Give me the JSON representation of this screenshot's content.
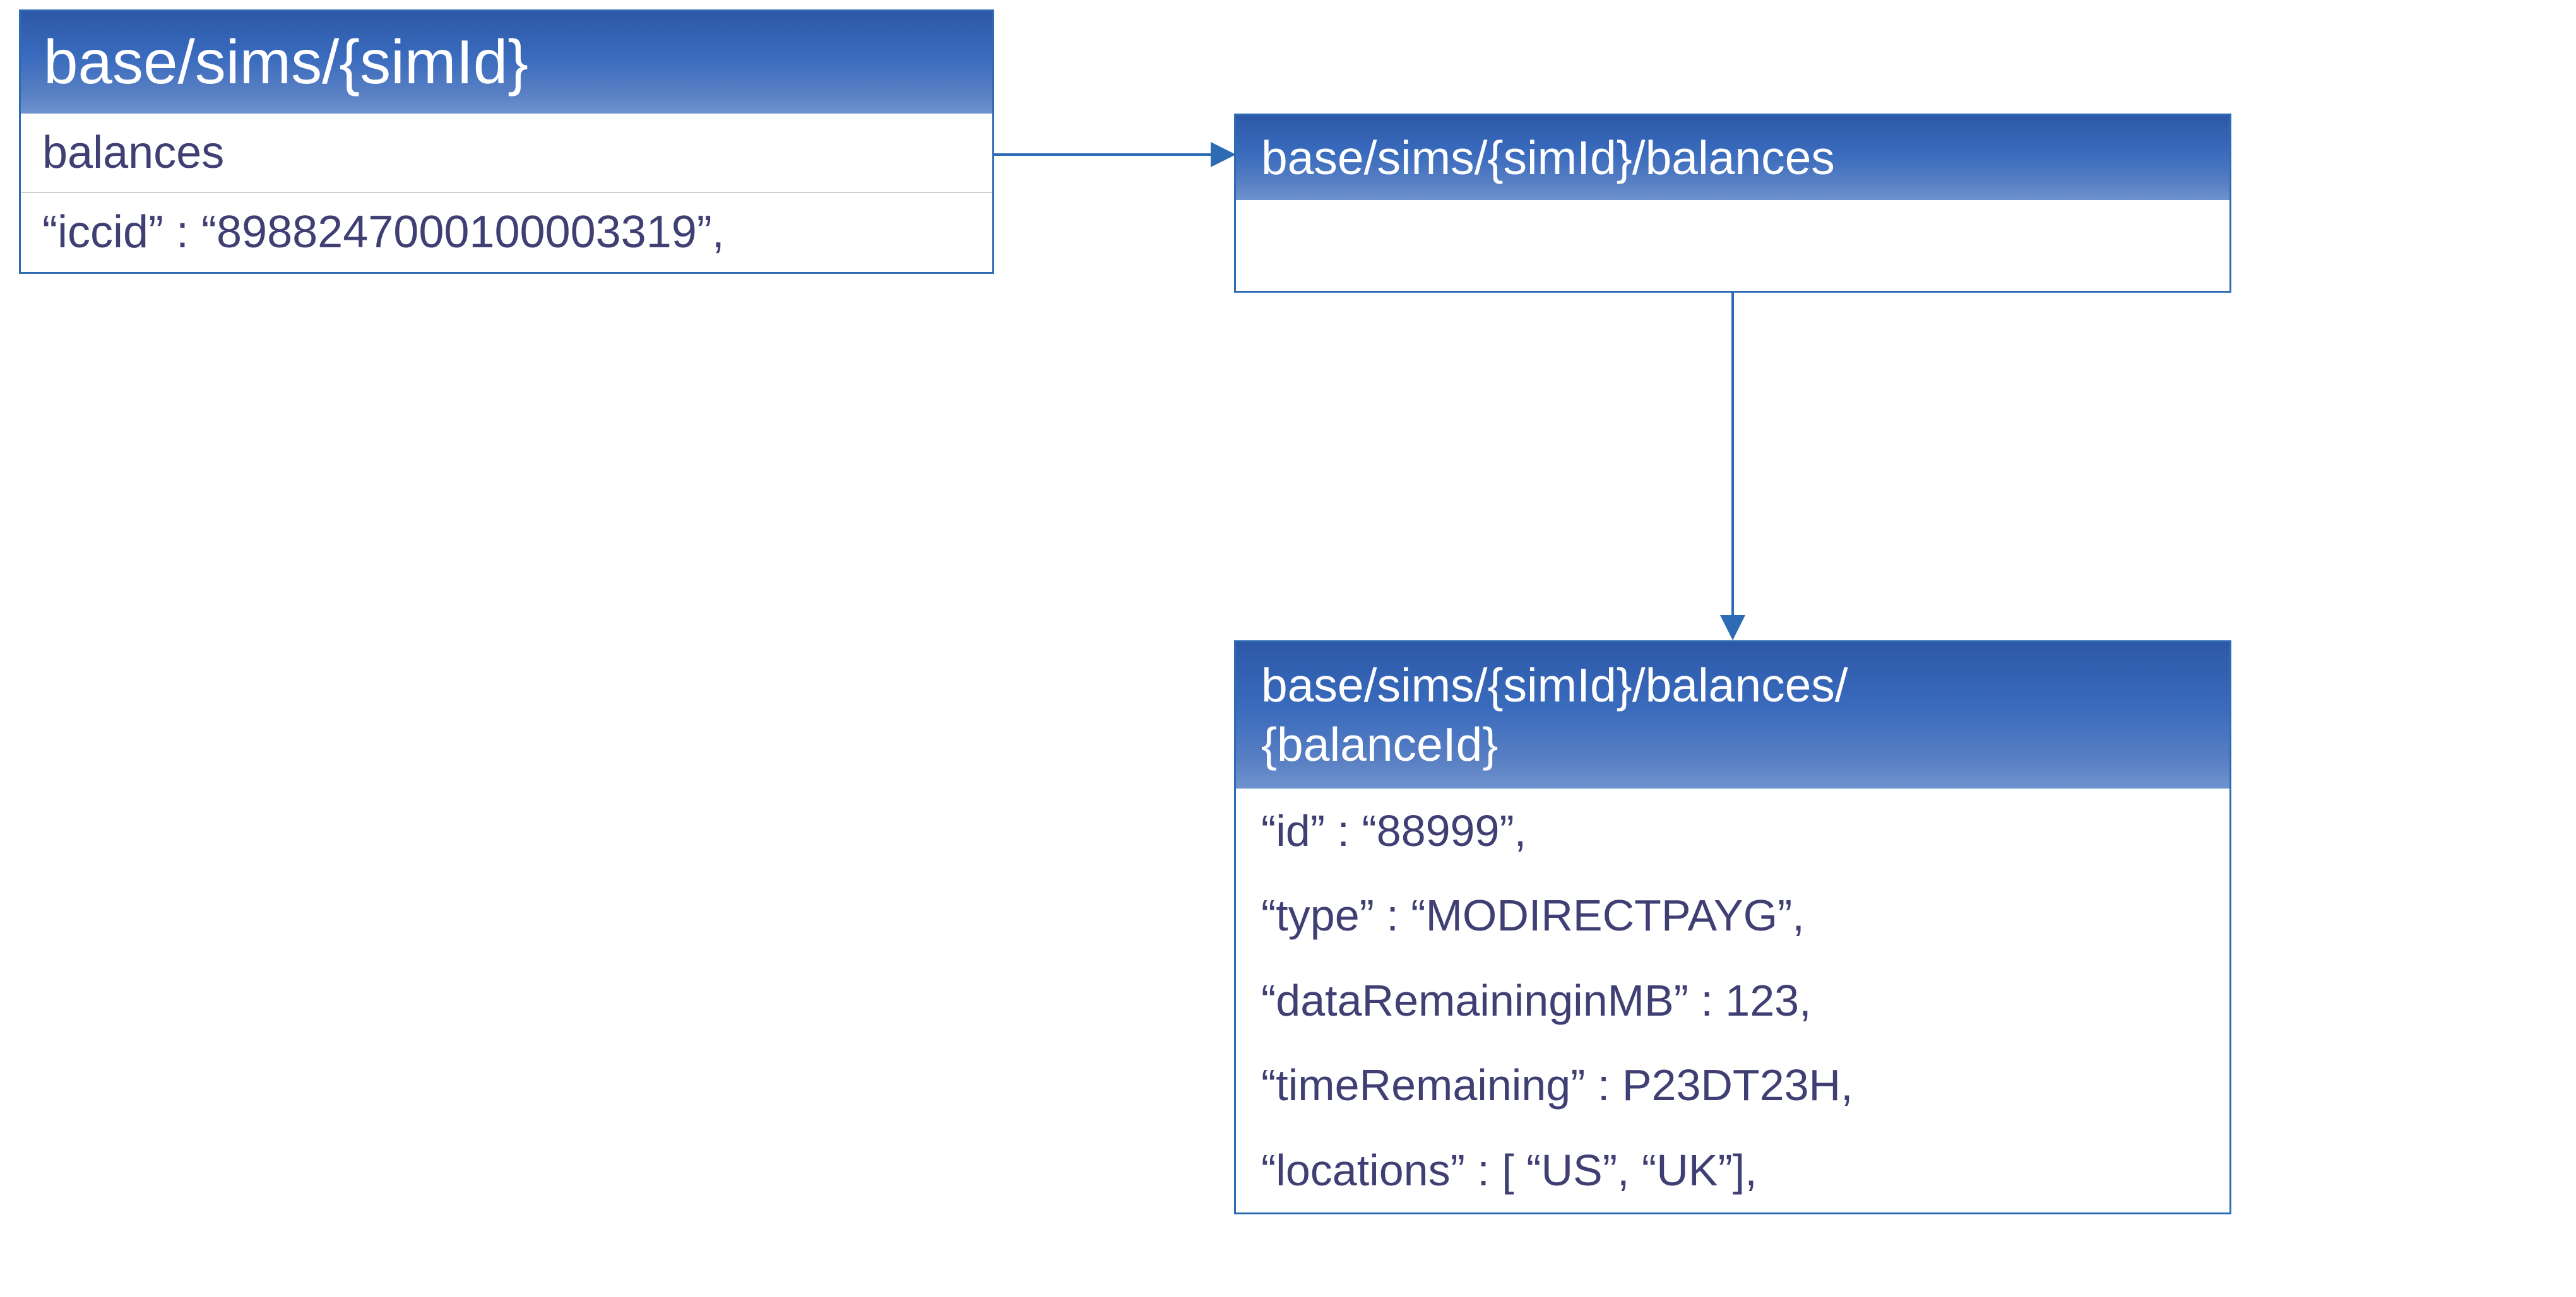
{
  "colors": {
    "border": "#2d6bb5",
    "text": "#3f3f74"
  },
  "box1": {
    "title": "base/sims/{simId}",
    "rows": [
      "balances",
      "“iccid” : “8988247000100003319”,"
    ]
  },
  "box2": {
    "title": "base/sims/{simId}/balances"
  },
  "box3": {
    "title": "base/sims/{simId}/balances/\n{balanceId}",
    "rows": [
      "“id” : “88999”,",
      "“type” : “MODIRECTPAYG”,",
      "“dataRemaininginMB” : 123,",
      "“timeRemaining” : P23DT23H,",
      "“locations” : [ “US”, “UK”],"
    ]
  }
}
